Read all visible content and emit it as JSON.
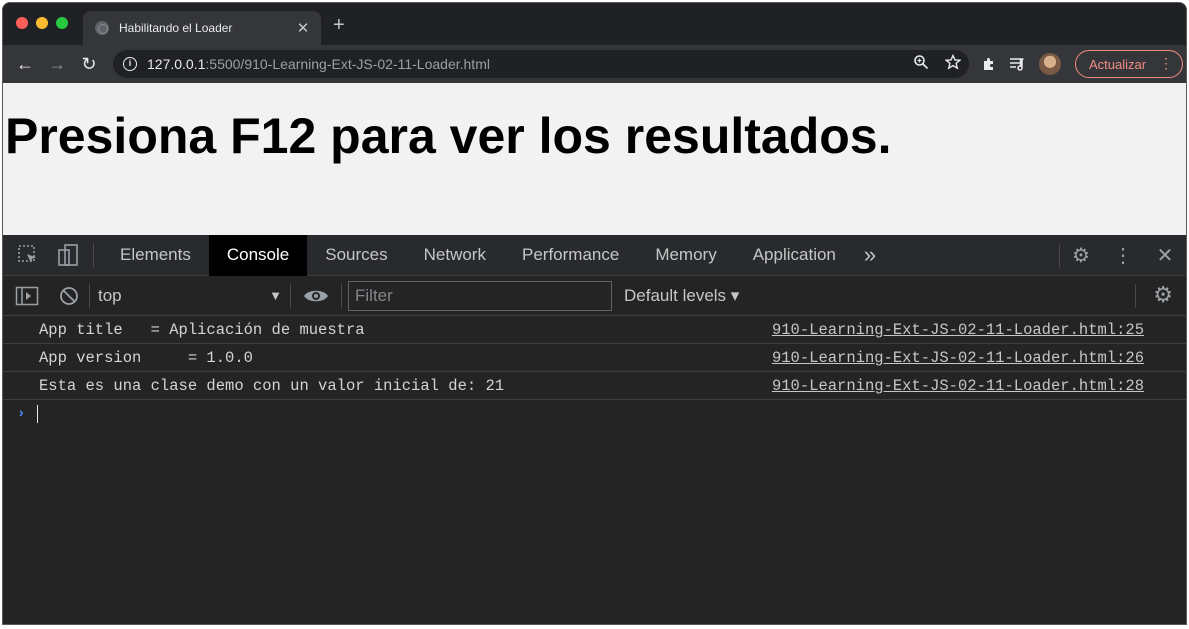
{
  "tab": {
    "title": "Habilitando el Loader",
    "close": "✕",
    "new_tab": "+"
  },
  "toolbar": {
    "back": "←",
    "forward": "→",
    "reload": "↻",
    "url_host": "127.0.0.1",
    "url_rest": ":5500/910-Learning-Ext-JS-02-11-Loader.html",
    "update_label": "Actualizar"
  },
  "page": {
    "heading": "Presiona F12 para ver los resultados."
  },
  "devtools": {
    "tabs": [
      {
        "label": "Elements"
      },
      {
        "label": "Console"
      },
      {
        "label": "Sources"
      },
      {
        "label": "Network"
      },
      {
        "label": "Performance"
      },
      {
        "label": "Memory"
      },
      {
        "label": "Application"
      }
    ],
    "more_tabs": "»",
    "context": "top",
    "filter_placeholder": "Filter",
    "levels": "Default levels ▾"
  },
  "console": {
    "rows": [
      {
        "message": "App title   = Aplicación de muestra",
        "source": "910-Learning-Ext-JS-02-11-Loader.html:25"
      },
      {
        "message": "App version     = 1.0.0",
        "source": "910-Learning-Ext-JS-02-11-Loader.html:26"
      },
      {
        "message": "Esta es una clase demo con un valor inicial de: 21",
        "source": "910-Learning-Ext-JS-02-11-Loader.html:28"
      }
    ],
    "prompt": "›"
  },
  "colors": {
    "accent_prompt": "#4f8cff",
    "update_border": "#f28b82",
    "active_tab_bg": "#000000"
  }
}
